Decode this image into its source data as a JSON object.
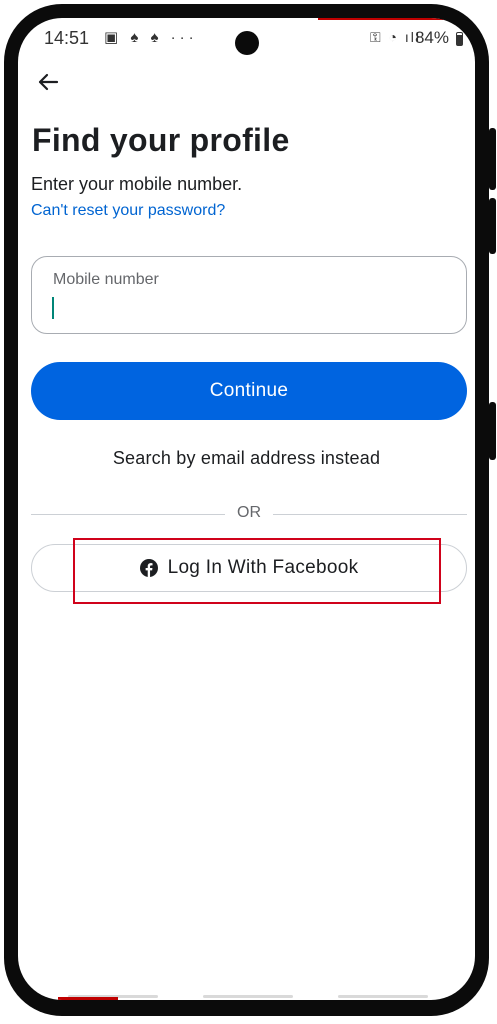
{
  "status_bar": {
    "time": "14:51",
    "left_icons": "▣ ♠ ♠ ···",
    "right_icons": "⚿ ◔ ıll",
    "battery_percent": "84%",
    "battery_level": 0.84
  },
  "header": {
    "back_icon": "arrow-left-icon"
  },
  "main": {
    "title": "Find your profile",
    "subtitle": "Enter your mobile number.",
    "cant_reset_link": "Can't reset your password?",
    "mobile_input": {
      "label": "Mobile number",
      "value": ""
    },
    "continue_label": "Continue",
    "search_email_label": "Search by email address instead",
    "divider_text": "OR",
    "facebook_login_label": "Log In With Facebook"
  },
  "colors": {
    "primary_blue": "#0064e0",
    "link_blue": "#0064d1",
    "highlight_red": "#d0021b",
    "caret_teal": "#008577"
  }
}
